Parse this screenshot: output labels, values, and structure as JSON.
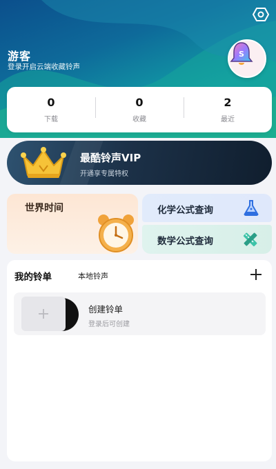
{
  "header": {
    "user_name": "游客",
    "user_subtitle": "登录开启云端收藏铃声",
    "settings_icon": "settings-eye-icon",
    "avatar_icon": "bell-avatar-icon",
    "colors": {
      "gradient_start": "#0b4f8c",
      "gradient_end": "#1aa88f"
    }
  },
  "stats": [
    {
      "value": "0",
      "label": "下载"
    },
    {
      "value": "0",
      "label": "收藏"
    },
    {
      "value": "2",
      "label": "最近"
    }
  ],
  "vip": {
    "title": "最酷铃声VIP",
    "subtitle": "开通享专属特权",
    "icon": "crown-icon"
  },
  "features": {
    "world_time": {
      "label": "世界时间",
      "icon": "alarm-clock-icon"
    },
    "chemistry": {
      "label": "化学公式查询",
      "icon": "flask-icon"
    },
    "math": {
      "label": "数学公式查询",
      "icon": "ruler-pencil-icon"
    }
  },
  "playlists": {
    "tab_mine": "我的铃单",
    "tab_local": "本地铃声",
    "add_icon": "plus-icon",
    "create": {
      "title": "创建铃单",
      "subtitle": "登录后可创建",
      "icon": "plus-icon"
    }
  }
}
